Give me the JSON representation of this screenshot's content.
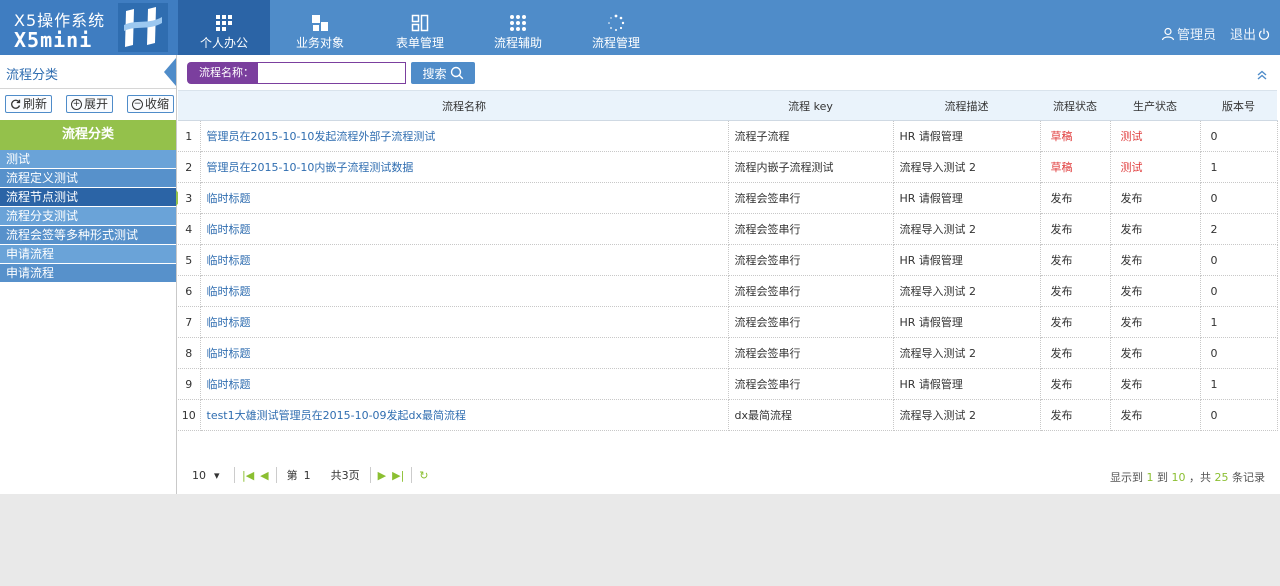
{
  "brand": {
    "title": "X5操作系统",
    "subtitle": "X5mini"
  },
  "nav": [
    {
      "label": "个人办公",
      "icon": "grid-icon"
    },
    {
      "label": "业务对象",
      "icon": "blocks-icon"
    },
    {
      "label": "表单管理",
      "icon": "form-icon"
    },
    {
      "label": "流程辅助",
      "icon": "dots-icon"
    },
    {
      "label": "流程管理",
      "icon": "spinner-icon"
    }
  ],
  "user": {
    "name": "管理员",
    "logout": "退出"
  },
  "left": {
    "title": "流程分类",
    "refresh": "刷新",
    "expand": "展开",
    "collapse": "收缩",
    "category_header": "流程分类",
    "categories": [
      "测试",
      "流程定义测试",
      "流程节点测试",
      "流程分支测试",
      "流程会签等多种形式测试",
      "申请流程",
      "申请流程"
    ]
  },
  "search": {
    "label": "流程名称：",
    "value": "",
    "button": "搜索"
  },
  "table": {
    "columns": [
      "",
      "流程名称",
      "流程 key",
      "流程描述",
      "流程状态",
      "生产状态",
      "版本号"
    ],
    "rows": [
      {
        "no": "1",
        "name": "管理员在2015-10-10发起流程外部子流程测试",
        "key": "流程子流程",
        "desc": "HR 请假管理",
        "status": "草稿",
        "prod": "测试",
        "ver": "0"
      },
      {
        "no": "2",
        "name": "管理员在2015-10-10内嵌子流程测试数据",
        "key": "流程内嵌子流程测试",
        "desc": "流程导入测试 2",
        "status": "草稿",
        "prod": "测试",
        "ver": "1"
      },
      {
        "no": "3",
        "name": "临时标题",
        "key": "流程会签串行",
        "desc": "HR 请假管理",
        "status": "发布",
        "prod": "发布",
        "ver": "0"
      },
      {
        "no": "4",
        "name": "临时标题",
        "key": "流程会签串行",
        "desc": "流程导入测试 2",
        "status": "发布",
        "prod": "发布",
        "ver": "2"
      },
      {
        "no": "5",
        "name": "临时标题",
        "key": "流程会签串行",
        "desc": "HR 请假管理",
        "status": "发布",
        "prod": "发布",
        "ver": "0"
      },
      {
        "no": "6",
        "name": "临时标题",
        "key": "流程会签串行",
        "desc": "流程导入测试 2",
        "status": "发布",
        "prod": "发布",
        "ver": "0"
      },
      {
        "no": "7",
        "name": "临时标题",
        "key": "流程会签串行",
        "desc": "HR 请假管理",
        "status": "发布",
        "prod": "发布",
        "ver": "1"
      },
      {
        "no": "8",
        "name": "临时标题",
        "key": "流程会签串行",
        "desc": "流程导入测试 2",
        "status": "发布",
        "prod": "发布",
        "ver": "0"
      },
      {
        "no": "9",
        "name": "临时标题",
        "key": "流程会签串行",
        "desc": "HR 请假管理",
        "status": "发布",
        "prod": "发布",
        "ver": "1"
      },
      {
        "no": "10",
        "name": "test1大雄测试管理员在2015-10-09发起dx最简流程",
        "key": "dx最简流程",
        "desc": "流程导入测试 2",
        "status": "发布",
        "prod": "发布",
        "ver": "0"
      }
    ]
  },
  "pager": {
    "page_size": "10",
    "page_prefix": "第",
    "page": "1",
    "total_pages": "共3页",
    "info_prefix": "显示到",
    "from": "1",
    "to_word": "到",
    "to": "10",
    "total_prefix": "，共",
    "total": "25",
    "total_suffix": "条记录"
  },
  "colors": {
    "header": "#4f8cc9",
    "active_nav": "#2b64a6",
    "category_header": "#94c14b",
    "draft": "#e03d3d",
    "link": "#2f6db0"
  }
}
